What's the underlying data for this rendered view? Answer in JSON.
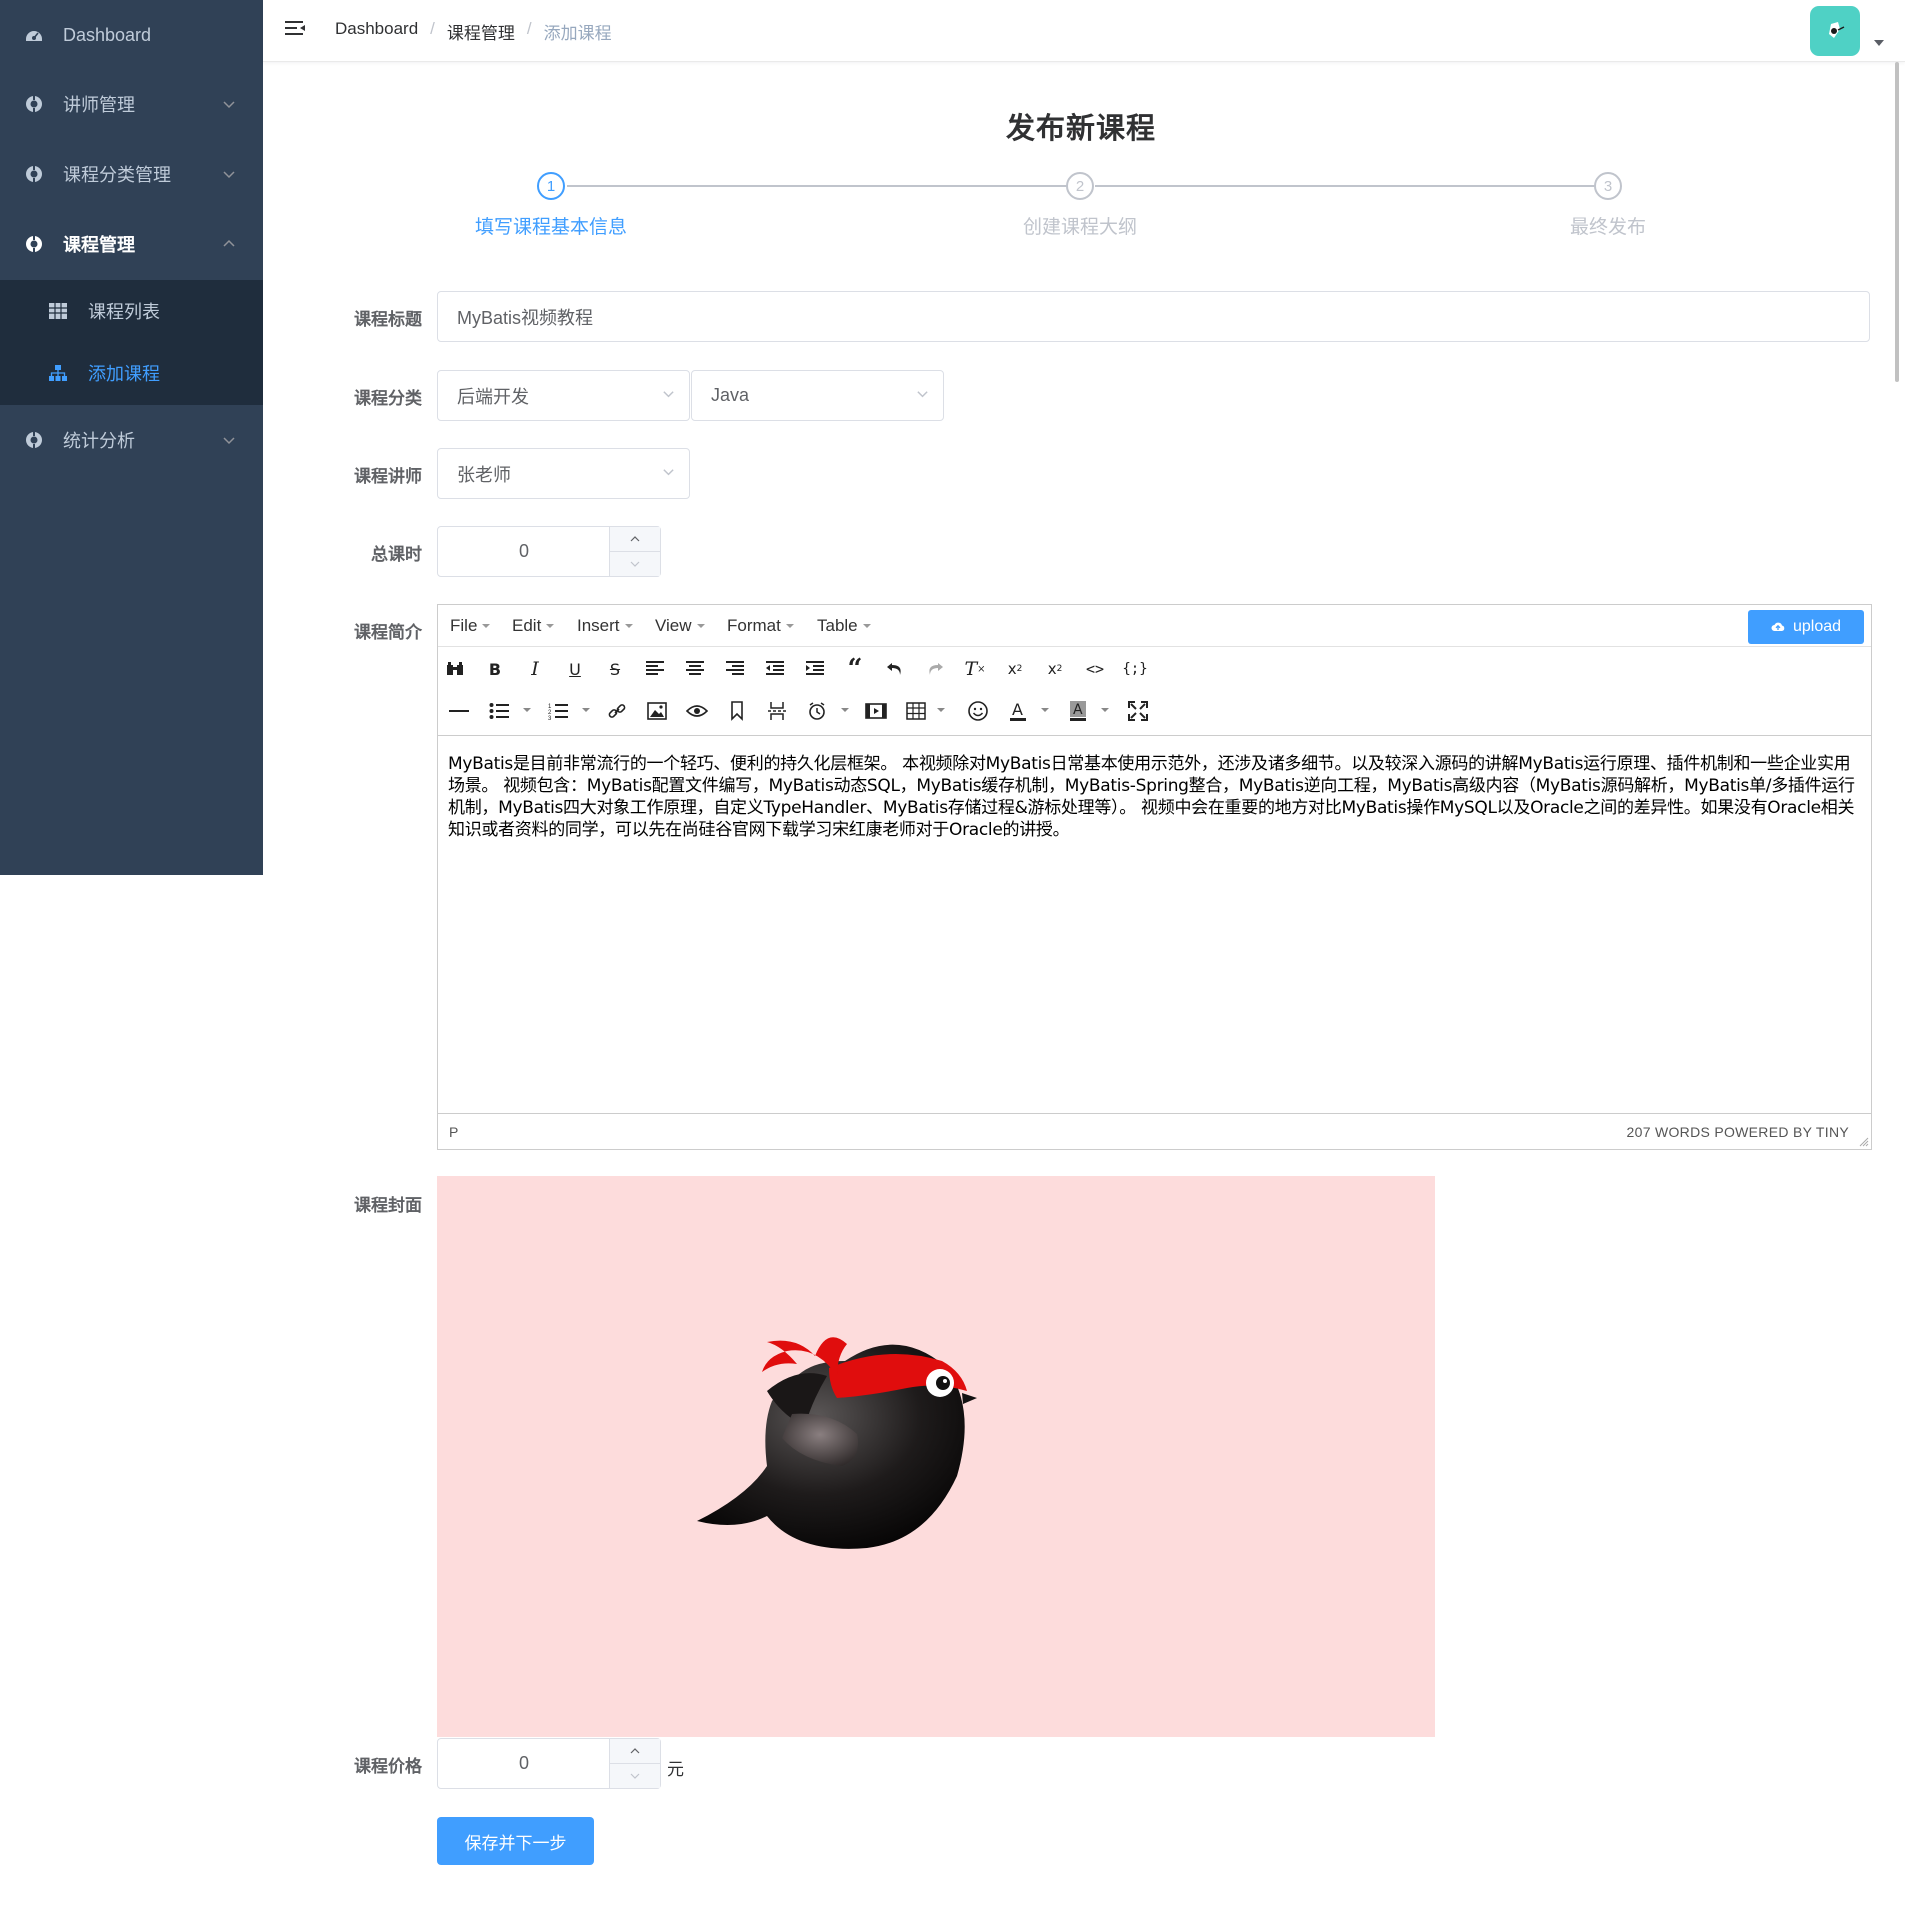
{
  "sidebar": {
    "items": [
      {
        "label": "Dashboard",
        "icon": "dashboard-icon"
      },
      {
        "label": "讲师管理",
        "icon": "example-icon"
      },
      {
        "label": "课程分类管理",
        "icon": "example-icon"
      },
      {
        "label": "课程管理",
        "icon": "example-icon"
      },
      {
        "label": "统计分析",
        "icon": "example-icon"
      }
    ],
    "submenu": [
      {
        "label": "课程列表",
        "icon": "table-icon"
      },
      {
        "label": "添加课程",
        "icon": "tree-icon"
      }
    ]
  },
  "breadcrumb": [
    "Dashboard",
    "课程管理",
    "添加课程"
  ],
  "page": {
    "title": "发布新课程"
  },
  "steps": [
    {
      "num": "1",
      "label": "填写课程基本信息"
    },
    {
      "num": "2",
      "label": "创建课程大纲"
    },
    {
      "num": "3",
      "label": "最终发布"
    }
  ],
  "form": {
    "title_label": "课程标题",
    "title_value": "MyBatis视频教程",
    "category_label": "课程分类",
    "category_level1": "后端开发",
    "category_level2": "Java",
    "teacher_label": "课程讲师",
    "teacher_value": "张老师",
    "lessons_label": "总课时",
    "lessons_value": "0",
    "description_label": "课程简介",
    "cover_label": "课程封面",
    "price_label": "课程价格",
    "price_value": "0",
    "price_unit": "元",
    "save_button": "保存并下一步"
  },
  "editor": {
    "menus": [
      "File",
      "Edit",
      "Insert",
      "View",
      "Format",
      "Table"
    ],
    "upload_label": "upload",
    "content": "MyBatis是目前非常流行的一个轻巧、便利的持久化层框架。 本视频除对MyBatis日常基本使用示范外，还涉及诸多细节。以及较深入源码的讲解MyBatis运行原理、插件机制和一些企业实用场景。 视频包含：MyBatis配置文件编写，MyBatis动态SQL，MyBatis缓存机制，MyBatis-Spring整合，MyBatis逆向工程，MyBatis高级内容（MyBatis源码解析，MyBatis单/多插件运行机制，MyBatis四大对象工作原理，自定义TypeHandler、MyBatis存储过程&游标处理等）。 视频中会在重要的地方对比MyBatis操作MySQL以及Oracle之间的差异性。如果没有Oracle相关知识或者资料的同学，可以先在尚硅谷官网下载学习宋红康老师对于Oracle的讲授。",
    "status_path": "P",
    "status_right": "207 WORDS POWERED BY TINY"
  },
  "colors": {
    "sidebar_bg": "#304156",
    "submenu_bg": "#1f2d3d",
    "primary": "#409eff",
    "cover_bg": "#fddcdc",
    "avatar_bg": "#4fd1c5"
  }
}
